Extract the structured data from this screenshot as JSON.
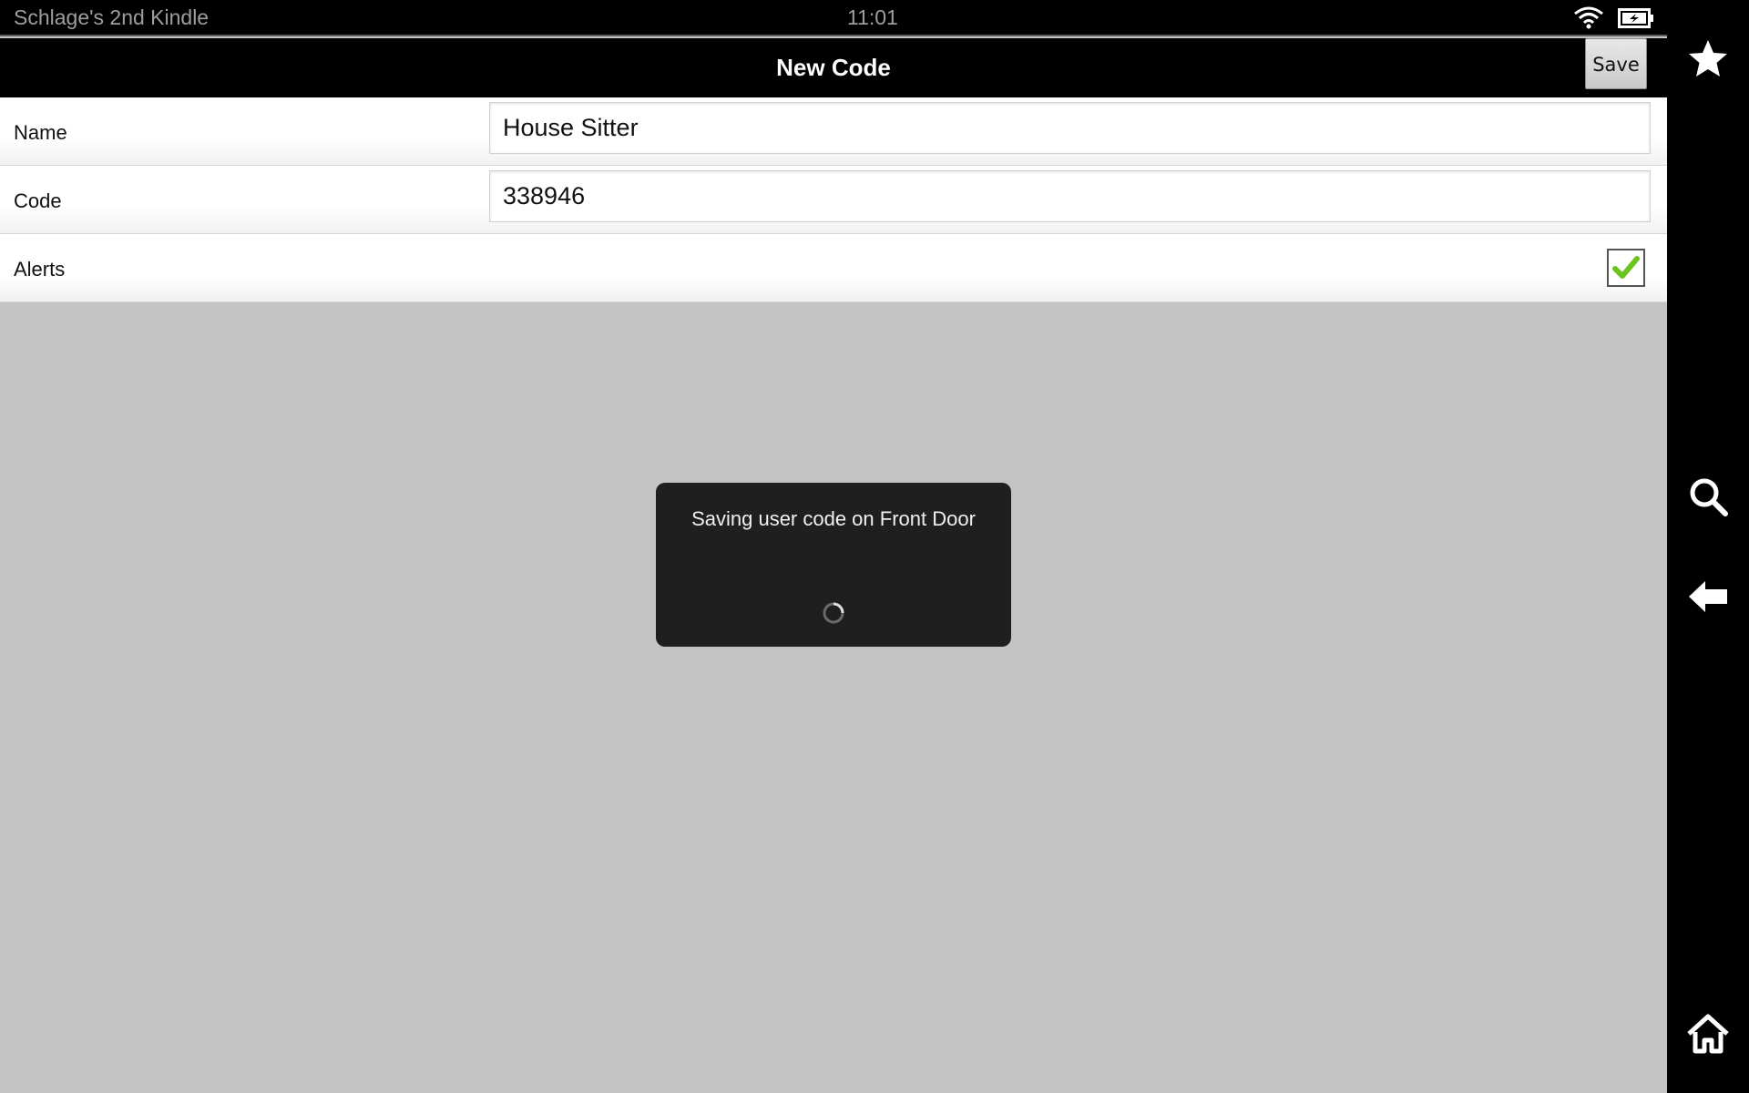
{
  "status_bar": {
    "device_name": "Schlage's 2nd Kindle",
    "time": "11:01",
    "wifi_icon": "wifi-icon",
    "battery_icon": "battery-charging-icon"
  },
  "action_bar": {
    "title": "New Code",
    "save_label": "Save"
  },
  "form": {
    "name_label": "Name",
    "name_value": "House Sitter",
    "code_label": "Code",
    "code_value": "338946",
    "alerts_label": "Alerts",
    "alerts_checked": true
  },
  "dialog": {
    "message": "Saving user code on Front Door",
    "spinner_icon": "loading-spinner-icon"
  },
  "system_nav": {
    "items": [
      "star-icon",
      "search-icon",
      "back-arrow-icon",
      "home-icon"
    ]
  },
  "colors": {
    "check_green": "#6cc51f",
    "background": "#c4c4c4",
    "dialog_bg": "#1f1f1f"
  }
}
